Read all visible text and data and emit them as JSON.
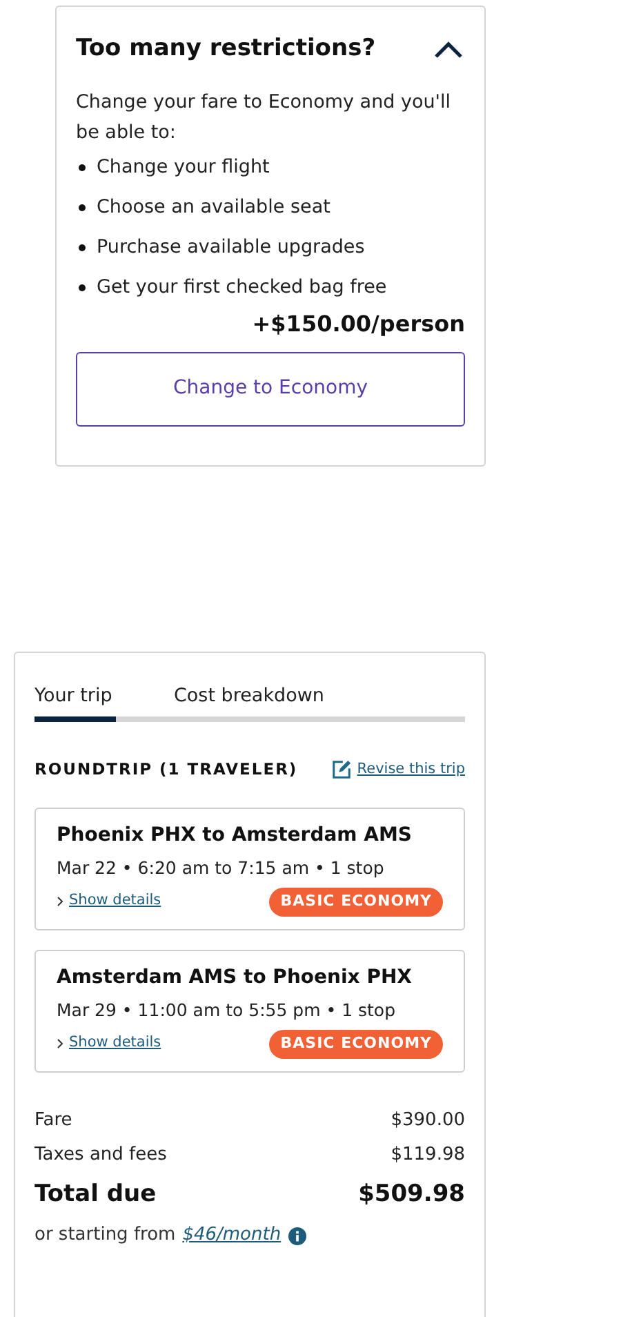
{
  "restrictions_panel": {
    "title": "Too many restrictions?",
    "expanded": true,
    "intro": "Change your fare to Economy and you'll be able to:",
    "benefits": [
      "Change your flight",
      "Choose an available seat",
      "Purchase available upgrades",
      "Get your first checked bag free"
    ],
    "price": "+$150.00/person",
    "button": "Change to Economy"
  },
  "trip_summary": {
    "tabs": [
      {
        "label": "Your trip",
        "selected": true
      },
      {
        "label": "Cost breakdown",
        "selected": false
      }
    ],
    "heading": "ROUNDTRIP (1 TRAVELER)",
    "revise_link": "Revise this trip",
    "flights": [
      {
        "route": "Phoenix PHX to Amsterdam AMS",
        "details": "Mar 22 • 6:20 am to 7:15 am • 1 stop",
        "link": "Show details",
        "fare_badge": "BASIC ECONOMY"
      },
      {
        "route": "Amsterdam AMS to Phoenix PHX",
        "details": "Mar 29 • 11:00 am to 5:55 pm • 1 stop",
        "link": "Show details",
        "fare_badge": "BASIC ECONOMY"
      }
    ],
    "costs": [
      {
        "label": "Fare",
        "amount": "$390.00",
        "kind": "line"
      },
      {
        "label": "Taxes and fees",
        "amount": "$119.98",
        "kind": "line"
      },
      {
        "label": "Total due",
        "amount": "$509.98",
        "kind": "total"
      }
    ],
    "financing": {
      "text": "or starting from",
      "amount": "$46/month"
    }
  }
}
